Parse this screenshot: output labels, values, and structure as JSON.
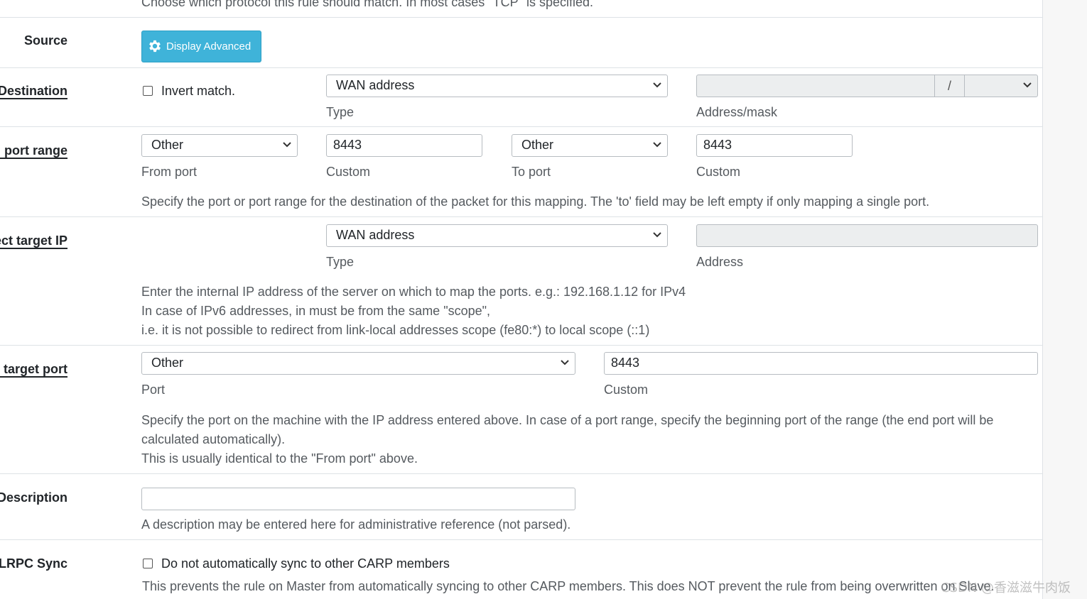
{
  "top_help": "Choose which protocol this rule should match. In most cases \"TCP\" is specified.",
  "source": {
    "label": "Source",
    "advanced_button": "Display Advanced"
  },
  "destination": {
    "label": "Destination",
    "invert_label": "Invert match.",
    "type_value": "WAN address",
    "type_caption": "Type",
    "address_value": "",
    "mask_separator": "/",
    "mask_value": "",
    "address_caption": "Address/mask"
  },
  "dest_port_range": {
    "label": "Destination port range",
    "from_value": "Other",
    "from_caption": "From port",
    "from_custom_value": "8443",
    "from_custom_caption": "Custom",
    "to_value": "Other",
    "to_caption": "To port",
    "to_custom_value": "8443",
    "to_custom_caption": "Custom",
    "help": "Specify the port or port range for the destination of the packet for this mapping. The 'to' field may be left empty if only mapping a single port."
  },
  "redirect_ip": {
    "label": "Redirect target IP",
    "type_value": "WAN address",
    "type_caption": "Type",
    "address_value": "",
    "address_caption": "Address",
    "help_line1": "Enter the internal IP address of the server on which to map the ports. e.g.: 192.168.1.12 for IPv4",
    "help_line2": "In case of IPv6 addresses, in must be from the same \"scope\",",
    "help_line3": "i.e. it is not possible to redirect from link-local addresses scope (fe80:*) to local scope (::1)"
  },
  "redirect_port": {
    "label": "Redirect target port",
    "port_value": "Other",
    "port_caption": "Port",
    "custom_value": "8443",
    "custom_caption": "Custom",
    "help_line1": "Specify the port on the machine with the IP address entered above. In case of a port range, specify the beginning port of the range (the end port will be",
    "help_line2": "calculated automatically).",
    "help_line3": "This is usually identical to the \"From port\" above."
  },
  "description": {
    "label": "Description",
    "value": "",
    "help": "A description may be entered here for administrative reference (not parsed)."
  },
  "xmlrpc": {
    "label": "No XMLRPC Sync",
    "checkbox_label": "Do not automatically sync to other CARP members",
    "help": "This prevents the rule on Master from automatically syncing to other CARP members. This does NOT prevent the rule from being overwritten on Slave."
  },
  "watermark": "CSDN @香滋滋牛肉饭",
  "colors": {
    "advanced_button_bg": "#3fb3d9",
    "text": "#212529",
    "help_text": "#555a5f",
    "disabled_input": "#eceeef"
  }
}
